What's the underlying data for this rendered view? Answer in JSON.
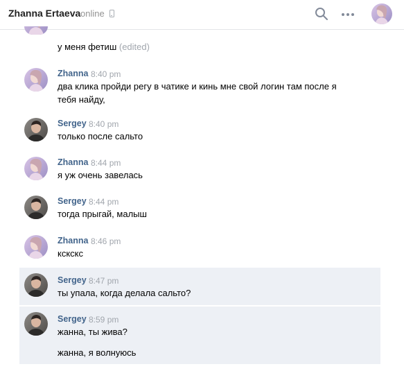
{
  "header": {
    "contact_name": "Zhanna Ertaeva",
    "status": "online",
    "status_icon": "phone-icon",
    "actions": [
      "search-icon",
      "more-icon",
      "avatar"
    ]
  },
  "messages": [
    {
      "text": "у меня фетиш",
      "edited": "(edited)"
    },
    {
      "author": "Zhanna",
      "time": "8:40 pm",
      "lines": [
        "два клика пройди регу в чатике и кинь мне свой логин там после я",
        "тебя найду,"
      ]
    },
    {
      "author": "Sergey",
      "time": "8:40 pm",
      "lines": [
        "только после сальто"
      ]
    },
    {
      "author": "Zhanna",
      "time": "8:44 pm",
      "lines": [
        "я уж очень завелась"
      ]
    },
    {
      "author": "Sergey",
      "time": "8:44 pm",
      "lines": [
        "тогда прыгай, малыш"
      ]
    },
    {
      "author": "Zhanna",
      "time": "8:46 pm",
      "lines": [
        "кскскс"
      ]
    },
    {
      "author": "Sergey",
      "time": "8:47 pm",
      "lines": [
        "ты упала, когда делала сальто?"
      ]
    },
    {
      "author": "Sergey",
      "time": "8:59 pm",
      "lines": [
        "жанна, ты жива?",
        "жанна, я волнуюсь"
      ]
    }
  ],
  "colors": {
    "author": "#42648b",
    "time": "#a1a6ad",
    "highlight": "#edf0f5"
  }
}
